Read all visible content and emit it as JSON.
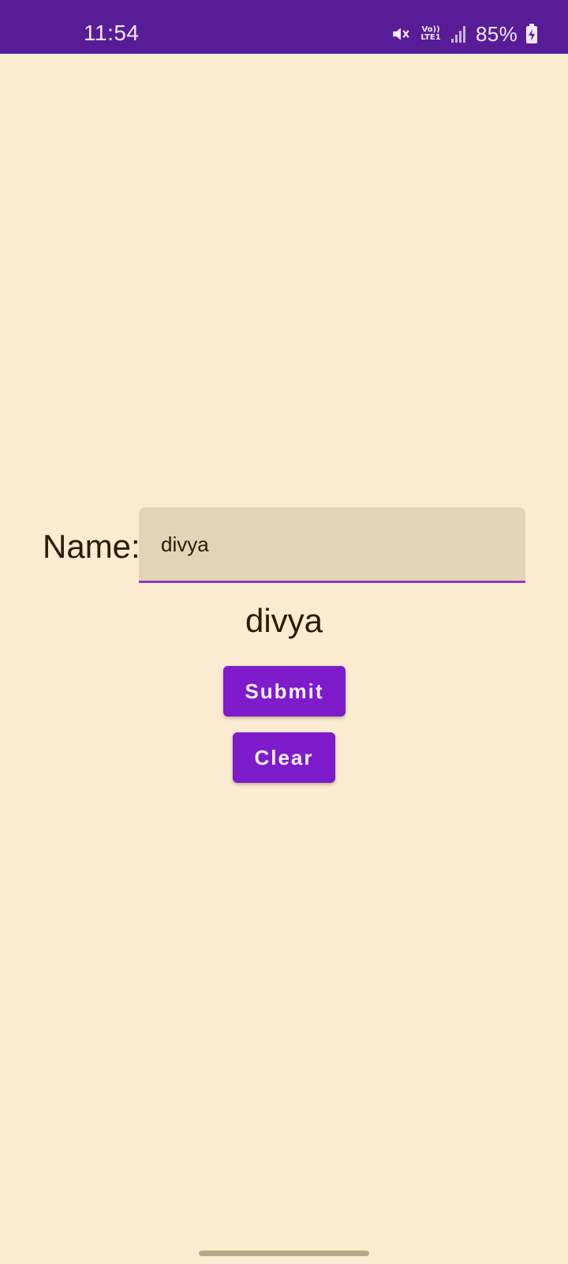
{
  "status_bar": {
    "time": "11:54",
    "volte_top": "Vo))",
    "volte_bottom": "LTE1",
    "battery_percent": "85%",
    "icons": [
      "mute-icon",
      "volte-icon",
      "signal-icon",
      "battery-charging-icon"
    ],
    "color": "#591C97"
  },
  "form": {
    "label": "Name:",
    "input_value": "divya",
    "output_text": "divya"
  },
  "buttons": {
    "submit": "Submit",
    "clear": "Clear"
  },
  "colors": {
    "background": "#FBEBD1",
    "field": "#E3D4B8",
    "accent": "#7E1BCB",
    "underline": "#8A3AC3",
    "text": "#2A1A06"
  }
}
